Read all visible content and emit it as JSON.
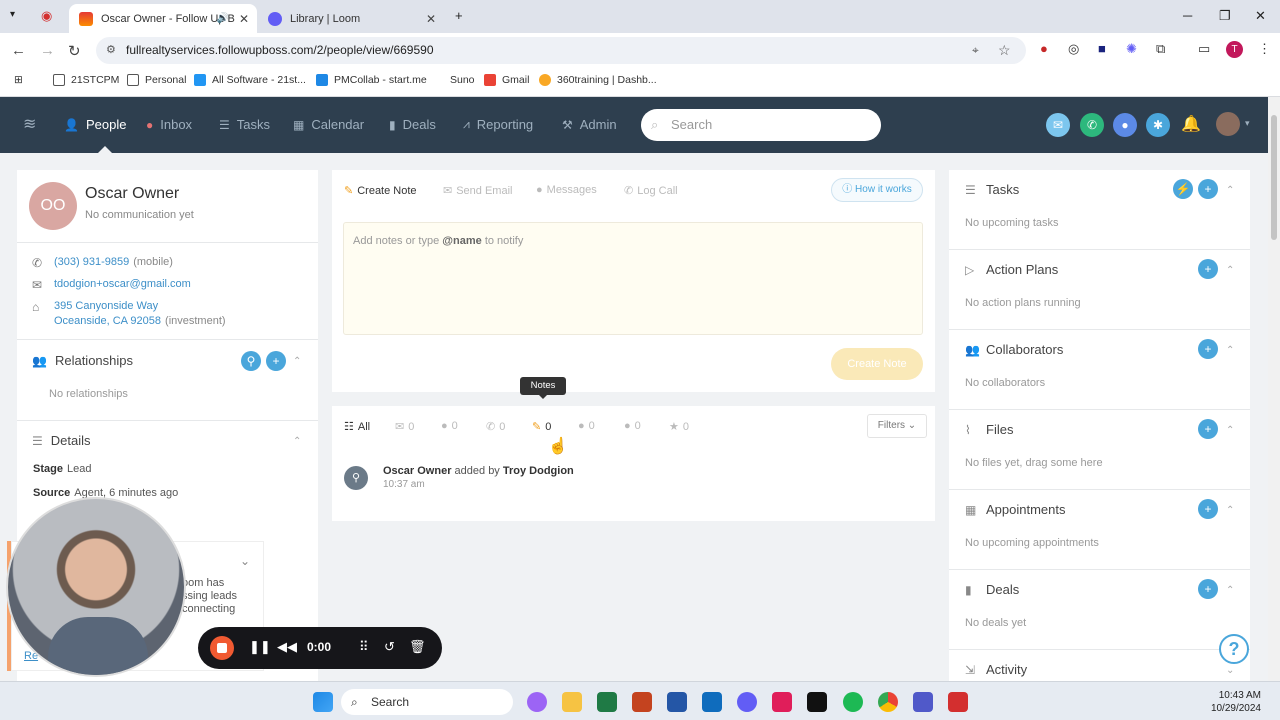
{
  "browser": {
    "tabs": [
      {
        "title": "Oscar Owner - Follow Up B",
        "active": true
      },
      {
        "title": "Library | Loom",
        "active": false
      }
    ],
    "url": "fullrealtyservices.followupboss.com/2/people/view/669590",
    "profile_initial": "T",
    "bookmarks": [
      "21STCPM",
      "Personal",
      "All Software - 21st...",
      "PMCollab - start.me",
      "Suno",
      "Gmail",
      "360training | Dashb..."
    ]
  },
  "nav": {
    "items": [
      "People",
      "Inbox",
      "Tasks",
      "Calendar",
      "Deals",
      "Reporting",
      "Admin"
    ],
    "active": "People",
    "search_placeholder": "Search"
  },
  "person": {
    "initials": "OO",
    "name": "Oscar Owner",
    "subtitle": "No communication yet",
    "phone": "(303) 931-9859",
    "phone_type": "(mobile)",
    "email": "tdodgion+oscar@gmail.com",
    "address_line1": "395 Canyonside Way",
    "address_line2": "Oceanside, CA 92058",
    "address_type": "(investment)"
  },
  "relationships": {
    "title": "Relationships",
    "empty": "No relationships"
  },
  "details": {
    "title": "Details",
    "stage_label": "Stage",
    "stage_value": "Lead",
    "source_label": "Source",
    "source_value": "Agent, 6 minutes ago"
  },
  "composer": {
    "tabs": [
      "Create Note",
      "Send Email",
      "Messages",
      "Log Call"
    ],
    "how_it_works": "How it works",
    "placeholder_pre": "Add notes or type",
    "placeholder_mention": "@name",
    "placeholder_post": "to notify",
    "create_button": "Create Note",
    "tooltip": "Notes"
  },
  "feed": {
    "all_label": "All",
    "counts": [
      "0",
      "0",
      "0",
      "0",
      "0",
      "0",
      "0"
    ],
    "filters_label": "Filters",
    "activity_person": "Oscar Owner",
    "activity_mid": "added by",
    "activity_actor": "Troy Dodgion",
    "activity_time": "10:37 am"
  },
  "right_panel": [
    {
      "title": "Tasks",
      "empty": "No upcoming tasks",
      "icon": "list-icon"
    },
    {
      "title": "Action Plans",
      "empty": "No action plans running",
      "icon": "play-icon"
    },
    {
      "title": "Collaborators",
      "empty": "No collaborators",
      "icon": "people-icon"
    },
    {
      "title": "Files",
      "empty": "No files yet, drag some here",
      "icon": "paperclip-icon"
    },
    {
      "title": "Appointments",
      "empty": "No upcoming appointments",
      "icon": "calendar-icon"
    },
    {
      "title": "Deals",
      "empty": "No deals yet",
      "icon": "lock-icon"
    },
    {
      "title": "Activity",
      "empty": "",
      "icon": "activity-icon"
    }
  ],
  "loom": {
    "notice_line1": "oom has",
    "notice_line2": "ssing leads",
    "notice_line3": "connecting",
    "notice_link": "Re",
    "timer": "0:00"
  },
  "taskbar": {
    "search": "Search",
    "time": "10:43 AM",
    "date": "10/29/2024"
  },
  "colors": {
    "nav_bg": "#2e3f4f",
    "accent": "#4aa6db",
    "avatar_bg": "#d9a7a2"
  }
}
